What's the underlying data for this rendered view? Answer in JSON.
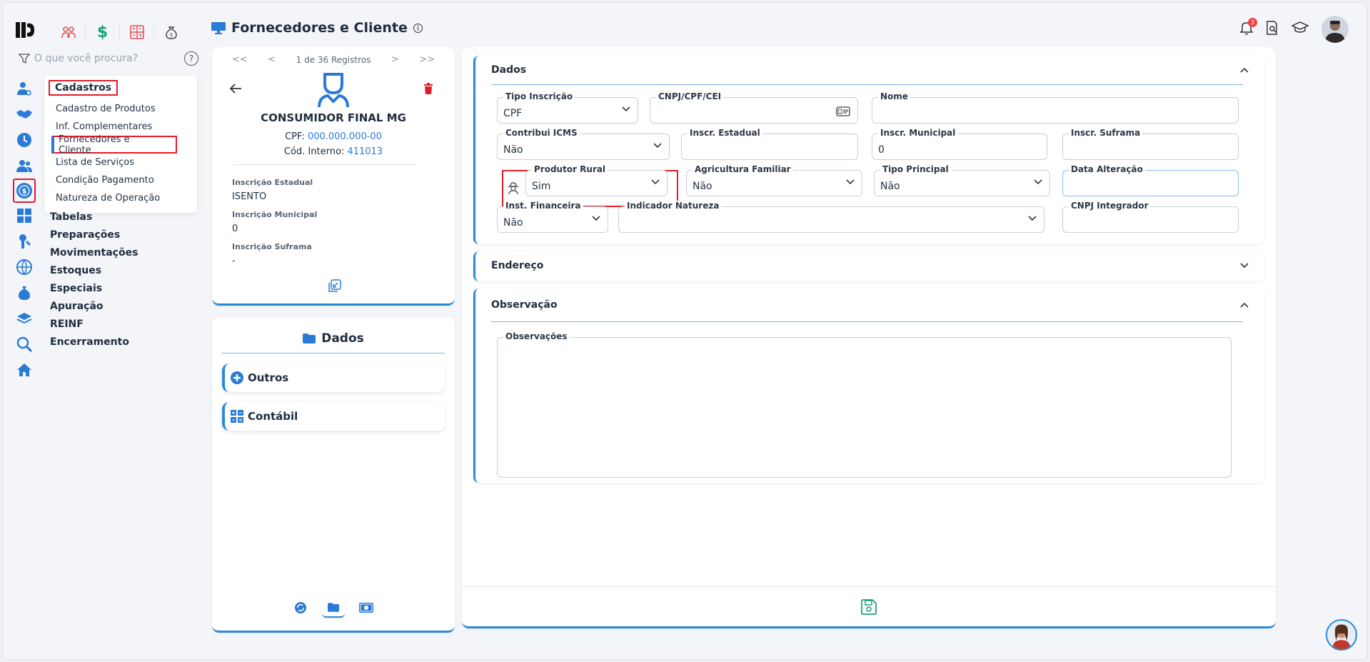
{
  "header": {
    "title": "Fornecedores e Cliente",
    "info_glyph": "i",
    "notifications_count": "3",
    "top_icons": [
      "users-icon",
      "dollar-icon",
      "calculator-icon",
      "money-bag-icon"
    ]
  },
  "search": {
    "placeholder": "O que você procura?",
    "help_glyph": "?"
  },
  "menu": {
    "section_title": "Cadastros",
    "items": [
      {
        "label": "Cadastro de Produtos"
      },
      {
        "label": "Inf. Complementares"
      },
      {
        "label": "Fornecedores e Cliente",
        "selected": true
      },
      {
        "label": "Lista de Serviços"
      },
      {
        "label": "Condição Pagamento"
      },
      {
        "label": "Natureza de Operação"
      }
    ],
    "groups": [
      {
        "label": "Tabelas"
      },
      {
        "label": "Preparações"
      },
      {
        "label": "Movimentações"
      },
      {
        "label": "Estoques"
      },
      {
        "label": "Especiais"
      },
      {
        "label": "Apuração"
      },
      {
        "label": "REINF"
      },
      {
        "label": "Encerramento"
      }
    ]
  },
  "record": {
    "nav_first": "<<",
    "nav_prev": "<",
    "counter": "1 de 36 Registros",
    "nav_next": ">",
    "nav_last": ">>",
    "name": "CONSUMIDOR FINAL MG",
    "cpf_label": "CPF:",
    "cpf_value": "000.000.000-00",
    "cod_label": "Cód. Interno:",
    "cod_value": "411013",
    "fields": [
      {
        "label": "Inscrição Estadual",
        "value": "ISENTO"
      },
      {
        "label": "Inscrição Municipal",
        "value": "0"
      },
      {
        "label": "Inscrição Suframa",
        "value": "-"
      }
    ]
  },
  "side_panel": {
    "title": "Dados",
    "buttons": [
      {
        "label": "Outros"
      },
      {
        "label": "Contábil"
      }
    ]
  },
  "form": {
    "sections": {
      "dados": "Dados",
      "endereco": "Endereço",
      "observacao": "Observação"
    },
    "tipo_inscricao": {
      "label": "Tipo Inscrição",
      "value": "CPF"
    },
    "cnpj": {
      "label": "CNPJ/CPF/CEI",
      "value": ""
    },
    "nome": {
      "label": "Nome",
      "value": ""
    },
    "contribui_icms": {
      "label": "Contribui ICMS",
      "value": "Não"
    },
    "inscr_estadual": {
      "label": "Inscr. Estadual",
      "value": ""
    },
    "inscr_municipal": {
      "label": "Inscr. Municipal",
      "value": "0"
    },
    "inscr_suframa": {
      "label": "Inscr. Suframa",
      "value": ""
    },
    "produtor_rural": {
      "label": "Produtor Rural",
      "value": "Sim"
    },
    "agricultura_familiar": {
      "label": "Agricultura Familiar",
      "value": "Não"
    },
    "tipo_principal": {
      "label": "Tipo Principal",
      "value": "Não"
    },
    "data_alteracao": {
      "label": "Data Alteração",
      "value": ""
    },
    "inst_financeira": {
      "label": "Inst. Financeira",
      "value": "Não"
    },
    "indicador_natureza": {
      "label": "Indicador Natureza",
      "value": ""
    },
    "cnpj_integrador": {
      "label": "CNPJ Integrador",
      "value": ""
    },
    "observacoes": {
      "label": "Observações",
      "value": ""
    }
  },
  "colors": {
    "accent": "#2b8ad6",
    "highlight": "#e11d2b",
    "save": "#1aa37a"
  }
}
